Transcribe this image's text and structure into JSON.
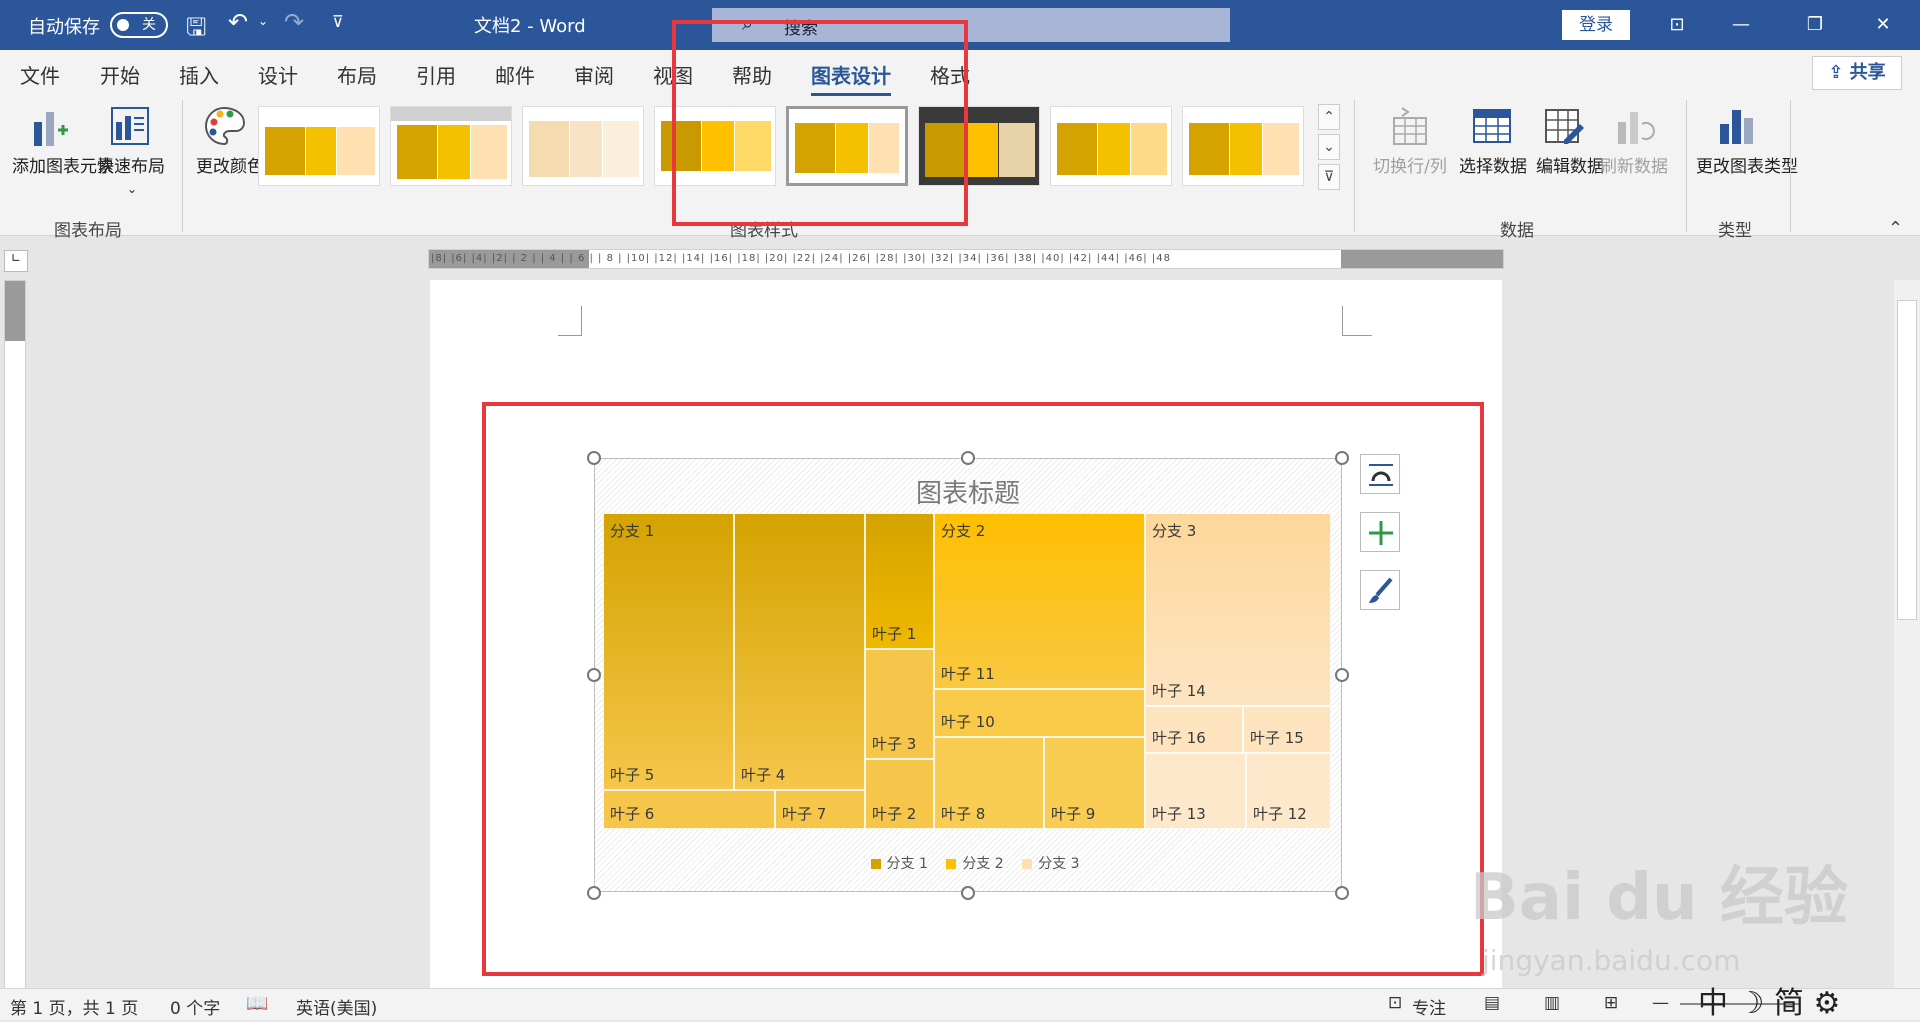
{
  "titlebar": {
    "autosave_label": "自动保存",
    "autosave_state": "关",
    "doc_title": "文档2  -  Word",
    "search_placeholder": "搜索",
    "login_label": "登录",
    "bg_color": "#2b579a"
  },
  "menu": {
    "tabs": [
      "文件",
      "开始",
      "插入",
      "设计",
      "布局",
      "引用",
      "邮件",
      "审阅",
      "视图",
      "帮助",
      "图表设计",
      "格式"
    ],
    "active_tab": "图表设计",
    "share_label": "共享"
  },
  "ribbon": {
    "add_chart_element": "添加图表元素",
    "quick_layout": "快速布局",
    "change_colors": "更改颜色",
    "switch_row_col": "切换行/列",
    "select_data": "选择数据",
    "edit_data": "编辑数据",
    "refresh_data": "刷新数据",
    "change_chart_type": "更改图表类型",
    "groups": {
      "chart_layout": "图表布局",
      "chart_styles": "图表样式",
      "data": "数据",
      "type": "类型"
    }
  },
  "chart": {
    "title": "图表标题",
    "legend": [
      {
        "name": "分支 1",
        "color": "#d4a300"
      },
      {
        "name": "分支 2",
        "color": "#ffc000"
      },
      {
        "name": "分支 3",
        "color": "#ffe0b0"
      }
    ]
  },
  "chart_data": {
    "type": "treemap",
    "title": "图表标题",
    "branches": [
      {
        "name": "分支 1",
        "leaves": [
          "叶子 5",
          "叶子 4",
          "叶子 6",
          "叶子 7"
        ]
      },
      {
        "name": "分支 2",
        "leaves": [
          "叶子 1",
          "叶子 3",
          "叶子 2",
          "叶子 11",
          "叶子 10",
          "叶子 8",
          "叶子 9"
        ]
      },
      {
        "name": "分支 3",
        "leaves": [
          "叶子 14",
          "叶子 16",
          "叶子 15",
          "叶子 13",
          "叶子 12"
        ]
      }
    ]
  },
  "status": {
    "page": "第 1 页，共 1 页",
    "words": "0 个字",
    "lang": "英语(美国)",
    "focus": "专注"
  },
  "watermark": {
    "brand": "Bai du 经验",
    "url": "jingyan.baidu.com"
  }
}
